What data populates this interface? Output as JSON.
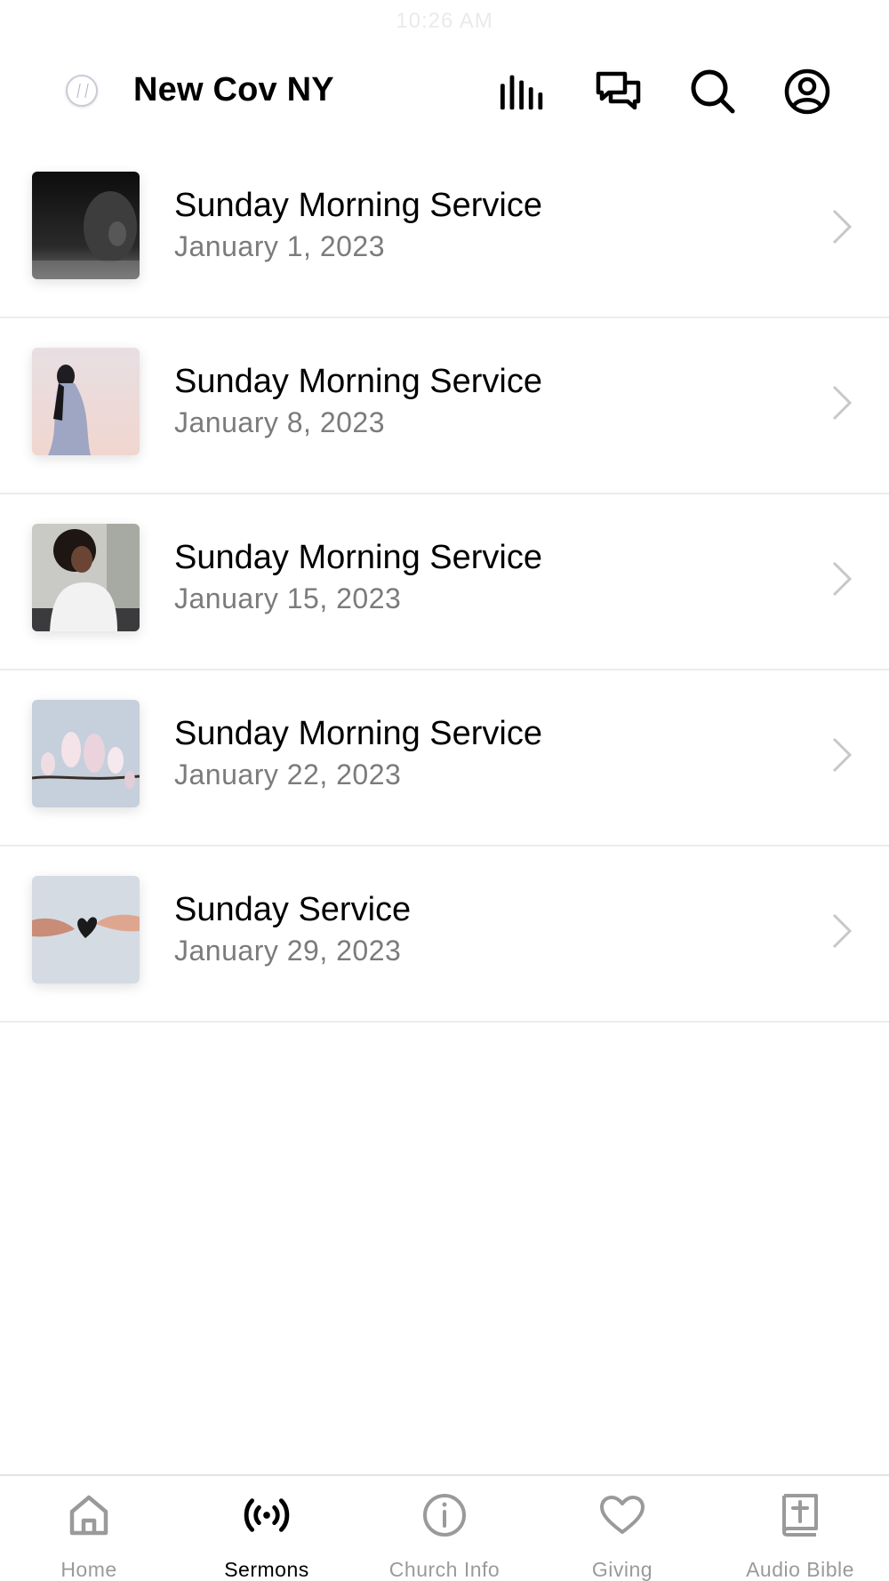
{
  "status_bar": {
    "time": "10:26 AM"
  },
  "header": {
    "title": "New Cov NY",
    "icons": [
      "audio-bars-icon",
      "chat-bubbles-icon",
      "search-icon",
      "account-icon"
    ]
  },
  "sermons": [
    {
      "title": "Sunday Morning Service",
      "date": "January 1, 2023",
      "thumbnail": "dark portrait"
    },
    {
      "title": "Sunday Morning Service",
      "date": "January 8, 2023",
      "thumbnail": "woman against sky"
    },
    {
      "title": "Sunday Morning Service",
      "date": "January 15, 2023",
      "thumbnail": "smiling woman"
    },
    {
      "title": "Sunday Morning Service",
      "date": "January 22, 2023",
      "thumbnail": "magnolia blossoms"
    },
    {
      "title": "Sunday Service",
      "date": "January 29, 2023",
      "thumbnail": "hands passing heart"
    }
  ],
  "tab_bar": {
    "tabs": [
      {
        "label": "Home",
        "icon": "home-icon",
        "active": false
      },
      {
        "label": "Sermons",
        "icon": "broadcast-icon",
        "active": true
      },
      {
        "label": "Church Info",
        "icon": "info-icon",
        "active": false
      },
      {
        "label": "Giving",
        "icon": "heart-icon",
        "active": false
      },
      {
        "label": "Audio Bible",
        "icon": "bible-icon",
        "active": false
      }
    ]
  },
  "colors": {
    "primary_text": "#000000",
    "secondary_text": "#7b7b7b",
    "inactive_tab": "#9a9a9a",
    "divider": "#ececec",
    "chevron": "#c7c7cc"
  }
}
